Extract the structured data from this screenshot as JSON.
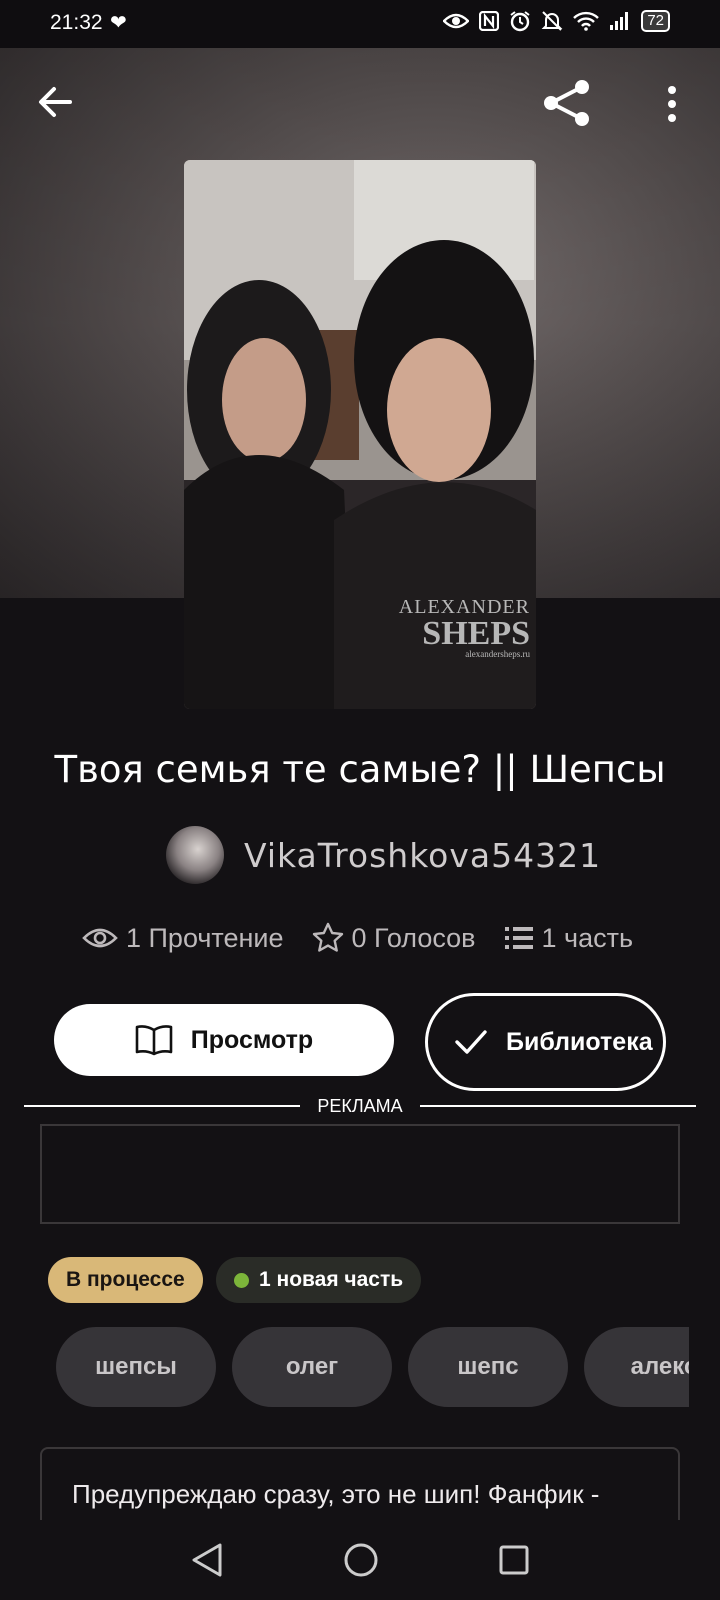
{
  "status_bar": {
    "time": "21:32",
    "battery": "72",
    "icons": [
      "heart-icon",
      "eye-icon",
      "nfc-icon",
      "alarm-icon",
      "mute-icon",
      "wifi-icon",
      "signal-icon",
      "battery-icon"
    ]
  },
  "header": {
    "back_icon": "arrow-left-icon",
    "share_icon": "share-icon",
    "more_icon": "more-vertical-icon"
  },
  "cover": {
    "watermark_line1": "ALEXANDER",
    "watermark_line2": "SHEPS",
    "watermark_line3": "alexandersheps.ru"
  },
  "story": {
    "title": "Твоя семья те самые? || Шепсы",
    "author": "VikaTroshkova54321"
  },
  "stats": {
    "reads": "1 Прочтение",
    "votes": "0 Голосов",
    "parts": "1 часть"
  },
  "actions": {
    "view_label": "Просмотр",
    "library_label": "Библиотека"
  },
  "ad": {
    "label": "РЕКЛАМА"
  },
  "badges": {
    "status": "В процессе",
    "new_parts": "1 новая часть"
  },
  "tags": [
    "шепсы",
    "олег",
    "шепс",
    "алекс"
  ],
  "description": "Предупреждаю сразу, это не шип! Фанфик - выдумка, никакого отношения к реальности",
  "colors": {
    "background": "#131114",
    "status_badge": "#d9b878",
    "new_dot": "#7cb53a",
    "tag_bg": "#363438"
  }
}
